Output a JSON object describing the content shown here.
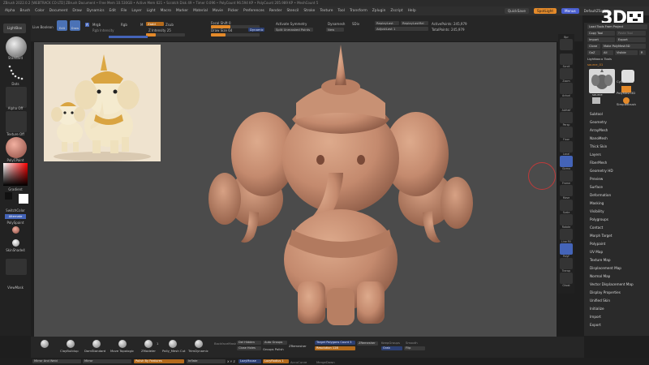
{
  "title_bar": "ZBrush 2022.0.2 [WEBTRACK CO LTD]   ZBrush Document   • Free Mem 10.530GB • Active Mem 621 • Scratch Disk 49 • Timer 0.096 • PolyCount 96.594 KP • PolyCount 205.989 KP • MeshCount 5",
  "menu": {
    "items": [
      "Alpha",
      "Brush",
      "Color",
      "Document",
      "Draw",
      "Dynamics",
      "Edit",
      "File",
      "Layer",
      "Light",
      "Macro",
      "Marker",
      "Material",
      "Movie",
      "Picker",
      "Preferences",
      "Render",
      "Stencil",
      "Stroke",
      "Texture",
      "Tool",
      "Transform",
      "Zplugin",
      "Zscript",
      "Help"
    ],
    "quicksave": "QuickSave",
    "spotlight": "SpotLight",
    "menus": "Menus",
    "script": "DefaultZScript"
  },
  "logo": "3D",
  "toolbar": {
    "lightbox": "LightBox",
    "live_boolean": "Live Boolean",
    "edit": "Edit",
    "draw": "Draw",
    "m": "M",
    "mrgb": "Mrgb",
    "rgb": "Rgb",
    "zadd": "Zadd",
    "zsub": "Zsub",
    "rgb_intensity": "Rgb Intensity",
    "z_intensity": "Z Intensity 25",
    "z_intensity_pct": 25,
    "focal_shift": "Focal Shift 0",
    "draw_size": "Draw Size 64",
    "dynamic": "Dynamic",
    "activate_symmetry": "Activate Symmetry",
    "split_unmasked": "Split Unmasked Points",
    "dynamesh": "Dynamesh",
    "new": "New",
    "sdiv": "SDiv",
    "replay_last": "ReplayLast",
    "replay_last_rel": "ReplayLastRel",
    "adjust_last": "AdjustLast 1",
    "active_points": "ActivePoints: 245,979",
    "total_points": "TotalPoints: 245,979"
  },
  "left_shelf": {
    "standard": "Standard",
    "dots": "Dots",
    "alpha_off": "Alpha Off",
    "texture_off": "Texture Off",
    "material": "PolyCPaint",
    "gradient": "Gradient",
    "switch_color": "SwitchColor",
    "alternate": "Alternate",
    "polyspaint": "PolySpaint",
    "skinshade4": "SkinShade4",
    "viewmask": "ViewMask"
  },
  "tool_column": [
    "Bpr",
    "Scroll",
    "Zoom",
    "Actual",
    "AAHalf",
    "Persp",
    "Floor",
    "Local",
    "Gizmo",
    "Frame",
    "Move",
    "Scale",
    "Rotate",
    "Line Fill",
    "PolyF",
    "Transp",
    "Ghost",
    "Solo",
    "Xpose"
  ],
  "right_panel": {
    "header": {
      "load_tool": "Load Tools From Project",
      "copy_tool": "Copy Tool",
      "paste_tool": "Paste Tool",
      "import": "Import",
      "export": "Export",
      "clone": "Clone",
      "make_polymesh": "Make PolyMesh3D",
      "goz": "GoZ",
      "all": "All",
      "visible": "Visible",
      "r": "R",
      "lightbox_tools": "Lightbox ▸ Tools",
      "source": "source_01",
      "tool1": "source",
      "tool2": "Cylinder3D",
      "tool3": "PolyMesh3D",
      "tool4": "SimpleBrush"
    },
    "subtools": [
      "Subtool",
      "Geometry",
      "ArrayMesh",
      "NanoMesh",
      "Thick Skin",
      "Layers",
      "FiberMesh",
      "Geometry HD",
      "Preview",
      "Surface",
      "Deformation",
      "Masking",
      "Visibility",
      "Polygroups",
      "Contact",
      "Morph Target",
      "Polypaint",
      "UV Map",
      "Texture Map",
      "Displacement Map",
      "Normal Map",
      "Vector Displacement Map",
      "Display Properties",
      "Unified Skin",
      "Initialize",
      "Import",
      "Export"
    ]
  },
  "bottom": {
    "brushes": [
      "ClayBuildup",
      "DamStandard",
      "Move Topologic",
      "ZModeler",
      "Polly_Mesh Cut",
      "TrimDynamic"
    ],
    "zmodeler_count": "1",
    "backface_mask": "BackfaceMask",
    "del_hidden": "Del Hidden",
    "auto_groups": "Auto Groups",
    "close_holes": "Close Holes",
    "group_polish": "Groups Polish",
    "zremesher": "ZRemesher",
    "target_poly": "Target Polygons Count 5",
    "resolution": "Resolution 128",
    "keep_groups": "KeepGroups",
    "smooth": "Smooth",
    "grab": "Grab",
    "flip": "Flip",
    "mirror_weld": "Mirror And Weld",
    "mirror": "Mirror",
    "polish_features": "Polish By Features",
    "inflate": "Inflate",
    "xyz": "X Y Z",
    "lazymouse": "LazyMouse",
    "lazyradius": "LazyRadius 1",
    "accucurve": "AccuCurve",
    "merge_down": "MergeDown"
  },
  "colors": {
    "accent_orange": "#e48a2a",
    "accent_blue": "#4464b8",
    "model_clay": "#c48a6e",
    "viewport_bg": "#4b4b4b"
  }
}
